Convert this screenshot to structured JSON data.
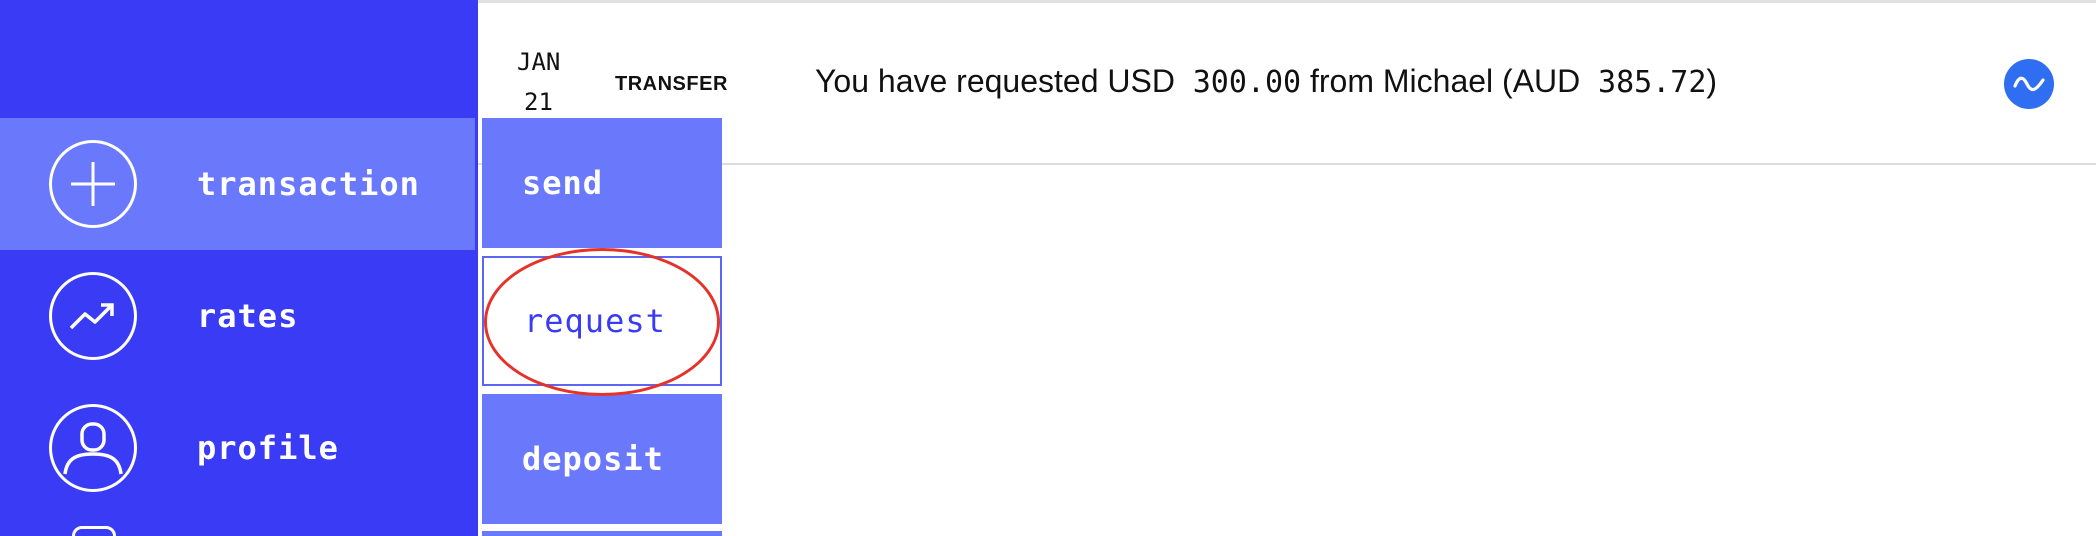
{
  "sidebar": {
    "items": [
      {
        "label": "transaction",
        "icon": "plus-icon",
        "active": true
      },
      {
        "label": "rates",
        "icon": "trending-up-icon",
        "active": false
      },
      {
        "label": "profile",
        "icon": "user-icon",
        "active": false
      }
    ]
  },
  "submenu": {
    "items": [
      {
        "label": "send",
        "selected": false
      },
      {
        "label": "request",
        "selected": true
      },
      {
        "label": "deposit",
        "selected": false
      }
    ]
  },
  "transaction": {
    "date_month": "JAN",
    "date_day": "21",
    "type": "TRANSFER",
    "text_prefix": "You have requested USD",
    "amount": "300.00",
    "text_middle": "from Michael (AUD",
    "converted_amount": "385.72",
    "text_suffix": ")",
    "status_icon": "pending-wave-icon"
  },
  "colors": {
    "sidebar": "#3a3cf5",
    "active": "#6a78fc",
    "status_icon": "#2f6ef0",
    "annotation": "#e5332a"
  }
}
